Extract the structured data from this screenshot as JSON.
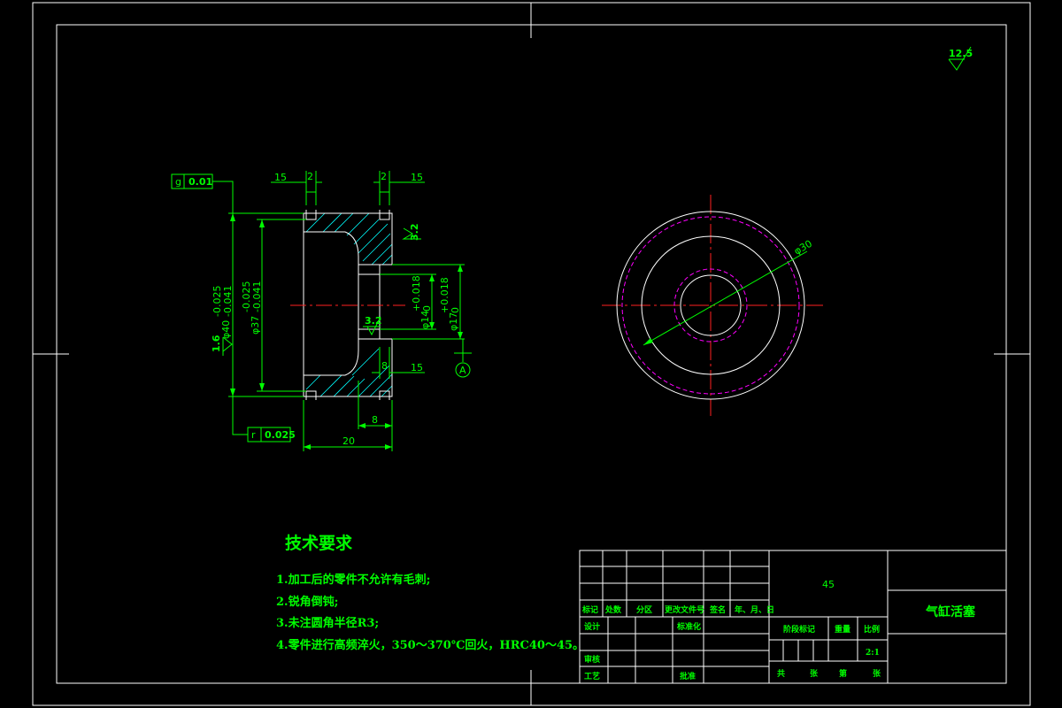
{
  "dims": {
    "d15_left": "15",
    "d2_left": "2",
    "d2_right": "2",
    "d15_right": "15",
    "d15_lower": "15",
    "d8_lower": "8",
    "d8_bottom": "8",
    "d20": "20",
    "phi40": "φ40",
    "phi40_tol_up": "-0.025",
    "phi40_tol_low": "-0.041",
    "phi37": "φ37",
    "phi37_tol_up": "-0.025",
    "phi37_tol_low": "-0.041",
    "phi14": "φ14",
    "phi14_tol_up": "+0.018",
    "phi14_tol_low": "0",
    "phi17": "φ17",
    "phi17_tol_up": "+0.018",
    "phi17_tol_low": "0",
    "phi30": "φ30"
  },
  "tolerances": {
    "top_symbol": "g",
    "top_value": "0.01",
    "bottom_symbol": "r",
    "bottom_value": "0.025",
    "datum": "A"
  },
  "roughness": {
    "corner": "12.5",
    "r1": "3.2",
    "r2": "3.2",
    "r3": "1.6"
  },
  "notes": {
    "title": "技术要求",
    "items": [
      "1.加工后的零件不允许有毛刺;",
      "2.锐角倒钝;",
      "3.未注圆角半径R3;",
      "4.零件进行高频淬火，350～370℃回火，HRC40～45。"
    ]
  },
  "title_block": {
    "material": "45",
    "part_name": "气缸活塞",
    "h_mark": "标记",
    "h_count": "处数",
    "h_zone": "分区",
    "h_change_doc": "更改文件号",
    "h_sign": "签名",
    "h_date": "年、月、日",
    "h_design": "设计",
    "h_standard": "标准化",
    "h_stage": "阶段标记",
    "h_weight": "重量",
    "h_scale": "比例",
    "scale_value": "2:1",
    "h_check": "审核",
    "h_process": "工艺",
    "h_approve": "批准",
    "t_total": "共",
    "t_sheets": "张",
    "t_no": "第",
    "t_sheet": "张"
  }
}
